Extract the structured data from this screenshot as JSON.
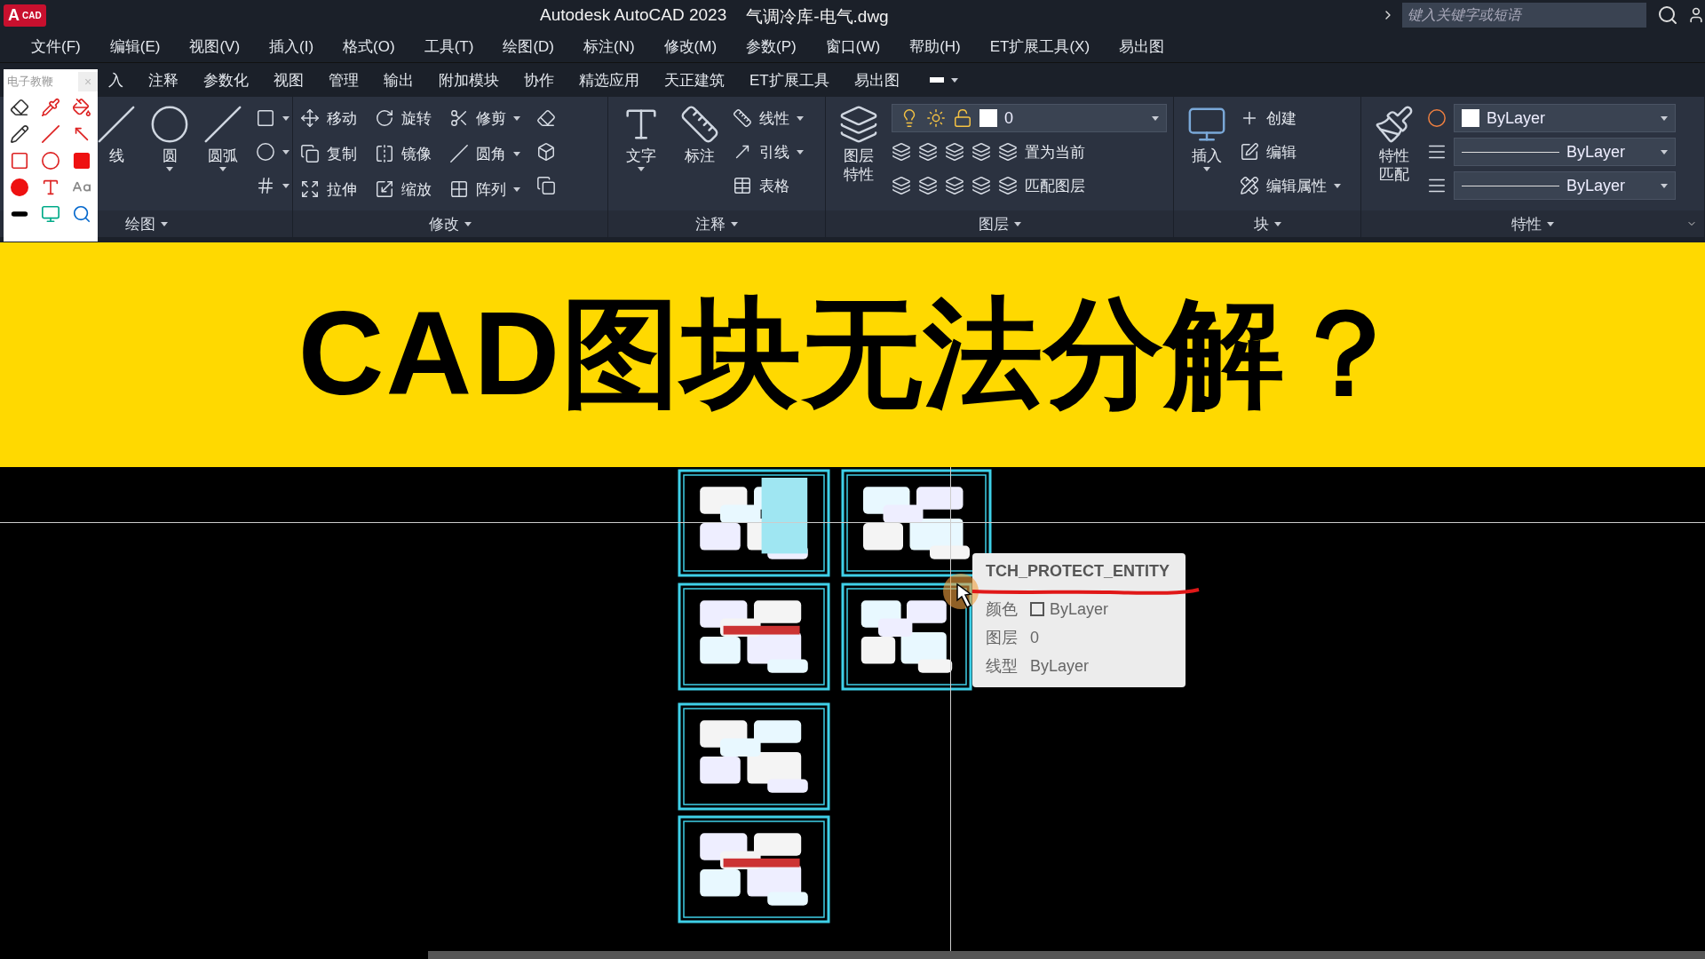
{
  "titlebar": {
    "logo": {
      "letter": "A",
      "text": "CAD"
    },
    "app": "Autodesk AutoCAD 2023",
    "file": "气调冷库-电气.dwg",
    "search": {
      "placeholder": "键入关键字或短语"
    }
  },
  "menu": [
    "文件(F)",
    "编辑(E)",
    "视图(V)",
    "插入(I)",
    "格式(O)",
    "工具(T)",
    "绘图(D)",
    "标注(N)",
    "修改(M)",
    "参数(P)",
    "窗口(W)",
    "帮助(H)",
    "ET扩展工具(X)",
    "易出图"
  ],
  "ribbon_tabs": [
    "入",
    "注释",
    "参数化",
    "视图",
    "管理",
    "输出",
    "附加模块",
    "协作",
    "精选应用",
    "天正建筑",
    "ET扩展工具",
    "易出图"
  ],
  "pen_toolbar": {
    "title": "电子教鞭",
    "close": "×"
  },
  "ribbon_panels": [
    {
      "kind": "draw",
      "title": "绘图",
      "large": [
        {
          "label": "线",
          "dropdown": false
        },
        {
          "label": "圆",
          "dropdown": true
        },
        {
          "label": "圆弧",
          "dropdown": true
        }
      ]
    },
    {
      "kind": "modify",
      "title": "修改",
      "small": [
        {
          "label": "移动",
          "dropdown": false
        },
        {
          "label": "旋转",
          "dropdown": false
        },
        {
          "label": "修剪",
          "dropdown": true
        },
        {
          "label": "复制",
          "dropdown": false
        },
        {
          "label": "镜像",
          "dropdown": false
        },
        {
          "label": "圆角",
          "dropdown": true
        },
        {
          "label": "拉伸",
          "dropdown": false
        },
        {
          "label": "缩放",
          "dropdown": false
        },
        {
          "label": "阵列",
          "dropdown": true
        }
      ]
    },
    {
      "kind": "annotate",
      "title": "注释",
      "large": [
        {
          "label": "文字",
          "dropdown": true
        },
        {
          "label": "标注",
          "dropdown": false
        }
      ],
      "small": [
        {
          "label": "线性",
          "dropdown": true
        },
        {
          "label": "引线",
          "dropdown": true
        },
        {
          "label": "表格",
          "dropdown": false
        }
      ]
    },
    {
      "kind": "layer",
      "title": "图层",
      "large": [
        {
          "label": "图层特性",
          "dropdown": false
        }
      ],
      "layer_select": "0",
      "small": [
        {
          "label": "置为当前",
          "dropdown": false
        },
        {
          "label": "匹配图层",
          "dropdown": false
        }
      ]
    },
    {
      "kind": "block",
      "title": "块",
      "large": [
        {
          "label": "插入",
          "dropdown": true
        }
      ],
      "small": [
        {
          "label": "创建",
          "dropdown": false
        },
        {
          "label": "编辑",
          "dropdown": false
        },
        {
          "label": "编辑属性",
          "dropdown": true
        }
      ]
    },
    {
      "kind": "properties",
      "title": "特性",
      "large": [
        {
          "label": "特性匹配",
          "dropdown": false
        }
      ],
      "selects": [
        "ByLayer",
        "ByLayer",
        "ByLayer"
      ]
    }
  ],
  "banner": {
    "headline": "CAD图块无法分解？"
  },
  "tooltip": {
    "title": "TCH_PROTECT_ENTITY",
    "rows": [
      {
        "label": "颜色",
        "value": "ByLayer",
        "swatch": true
      },
      {
        "label": "图层",
        "value": "0",
        "swatch": false
      },
      {
        "label": "线型",
        "value": "ByLayer",
        "swatch": false
      }
    ]
  }
}
